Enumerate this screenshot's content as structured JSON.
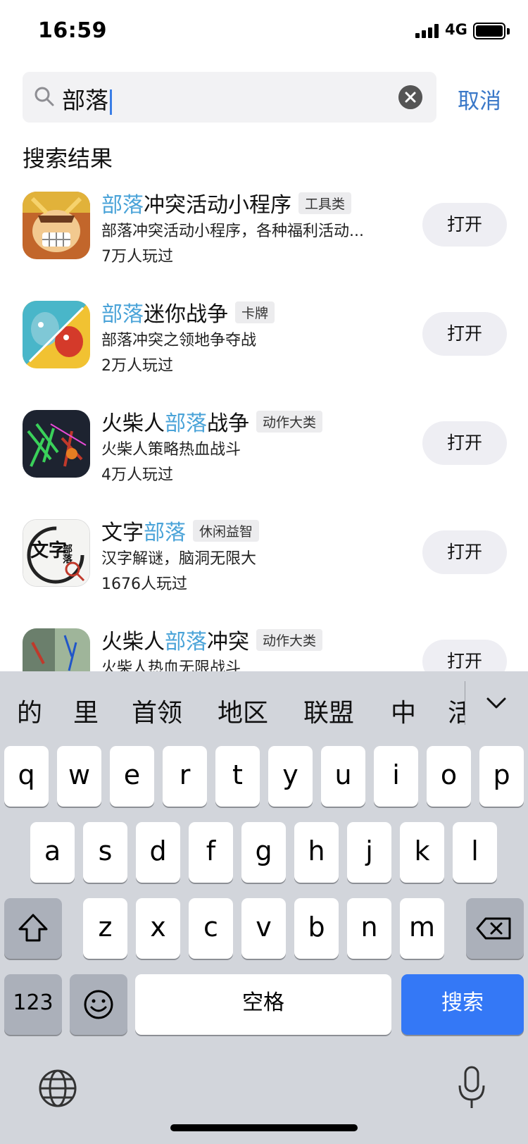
{
  "status_bar": {
    "time": "16:59",
    "network": "4G",
    "battery_percent": 100
  },
  "search": {
    "query": "部落",
    "cancel_label": "取消"
  },
  "section_title": "搜索结果",
  "results": [
    {
      "name_hl": "部落",
      "name_rest": "冲突活动小程序",
      "name_pre": "",
      "tag": "工具类",
      "desc": "部落冲突活动小程序，各种福利活动...",
      "players": "7万人玩过",
      "button": "打开"
    },
    {
      "name_pre": "",
      "name_hl": "部落",
      "name_rest": "迷你战争",
      "tag": "卡牌",
      "desc": "部落冲突之领地争夺战",
      "players": "2万人玩过",
      "button": "打开"
    },
    {
      "name_pre": "火柴人",
      "name_hl": "部落",
      "name_rest": "战争",
      "tag": "动作大类",
      "desc": "火柴人策略热血战斗",
      "players": "4万人玩过",
      "button": "打开"
    },
    {
      "name_pre": "文字",
      "name_hl": "部落",
      "name_rest": "",
      "tag": "休闲益智",
      "desc": "汉字解谜，脑洞无限大",
      "players": "1676人玩过",
      "button": "打开"
    },
    {
      "name_pre": "火柴人",
      "name_hl": "部落",
      "name_rest": "冲突",
      "tag": "动作大类",
      "desc": "火柴人热血无限战斗",
      "players": "",
      "button": "打开"
    }
  ],
  "icon_text": {
    "wenzi_big": "文字",
    "wenzi_small": "部落"
  },
  "keyboard": {
    "candidates": [
      "的",
      "里",
      "首领",
      "地区",
      "联盟",
      "中",
      "活"
    ],
    "row1": [
      "q",
      "w",
      "e",
      "r",
      "t",
      "y",
      "u",
      "i",
      "o",
      "p"
    ],
    "row2": [
      "a",
      "s",
      "d",
      "f",
      "g",
      "h",
      "j",
      "k",
      "l"
    ],
    "row3": [
      "z",
      "x",
      "c",
      "v",
      "b",
      "n",
      "m"
    ],
    "numbers_label": "123",
    "space_label": "空格",
    "search_label": "搜索"
  },
  "colors": {
    "highlight": "#4aa3d8",
    "cancel": "#3a78c8",
    "search_key": "#3478f6"
  }
}
